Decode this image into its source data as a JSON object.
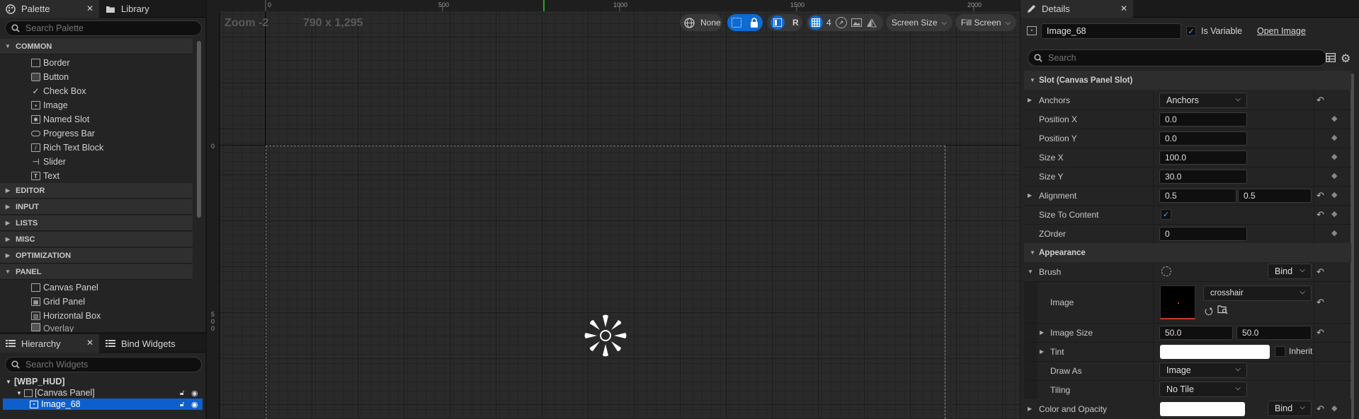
{
  "palette": {
    "tab_label": "Palette",
    "library_tab_label": "Library",
    "search_placeholder": "Search Palette",
    "common_label": "COMMON",
    "items": [
      {
        "label": "Border",
        "icon": "border-icon"
      },
      {
        "label": "Button",
        "icon": "button-icon"
      },
      {
        "label": "Check Box",
        "icon": "checkbox-icon"
      },
      {
        "label": "Image",
        "icon": "image-icon"
      },
      {
        "label": "Named Slot",
        "icon": "named-slot-icon"
      },
      {
        "label": "Progress Bar",
        "icon": "progress-bar-icon"
      },
      {
        "label": "Rich Text Block",
        "icon": "rich-text-icon"
      },
      {
        "label": "Slider",
        "icon": "slider-icon"
      },
      {
        "label": "Text",
        "icon": "text-icon"
      }
    ],
    "categories": [
      "EDITOR",
      "INPUT",
      "LISTS",
      "MISC",
      "OPTIMIZATION"
    ],
    "panel_label": "PANEL",
    "panel_items": [
      "Canvas Panel",
      "Grid Panel",
      "Horizontal Box",
      "Overlay"
    ]
  },
  "hierarchy": {
    "tab_label": "Hierarchy",
    "bind_tab_label": "Bind Widgets",
    "search_placeholder": "Search Widgets",
    "root": "[WBP_HUD]",
    "canvas": "[Canvas Panel]",
    "selected": "Image_68"
  },
  "viewport": {
    "zoom_label": "Zoom -2",
    "resolution_label": "790 x 1,295",
    "ruler_top": [
      "0",
      "500",
      "1000",
      "1500",
      "2000"
    ],
    "ruler_left": [
      "0",
      "5",
      "0",
      "0"
    ],
    "toolbar": {
      "none_label": "None",
      "r_label": "R",
      "grid_count": "4",
      "screen_size_label": "Screen Size",
      "fill_screen_label": "Fill Screen"
    }
  },
  "details": {
    "tab_label": "Details",
    "widget_name": "Image_68",
    "is_variable_label": "Is Variable",
    "is_variable": true,
    "open_image_label": "Open Image",
    "search_placeholder": "Search",
    "slot_section": "Slot (Canvas Panel Slot)",
    "anchors_label": "Anchors",
    "anchors_value": "Anchors",
    "position_x_label": "Position X",
    "position_x": "0.0",
    "position_y_label": "Position Y",
    "position_y": "0.0",
    "size_x_label": "Size X",
    "size_x": "100.0",
    "size_y_label": "Size Y",
    "size_y": "30.0",
    "alignment_label": "Alignment",
    "alignment_x": "0.5",
    "alignment_y": "0.5",
    "size_to_content_label": "Size To Content",
    "size_to_content": true,
    "zorder_label": "ZOrder",
    "zorder": "0",
    "appearance_section": "Appearance",
    "brush_label": "Brush",
    "bind_label": "Bind",
    "image_label": "Image",
    "image_asset": "crosshair",
    "image_size_label": "Image Size",
    "image_size_x": "50.0",
    "image_size_y": "50.0",
    "tint_label": "Tint",
    "inherit_label": "Inherit",
    "draw_as_label": "Draw As",
    "draw_as_value": "Image",
    "tiling_label": "Tiling",
    "tiling_value": "No Tile",
    "color_opacity_label": "Color and Opacity",
    "color_bind_label": "Bind"
  },
  "colors": {
    "accent": "#0d6bd1",
    "selection": "#0e5fcc",
    "canvas": "#2a2a2a",
    "tint": "#ffffff"
  }
}
